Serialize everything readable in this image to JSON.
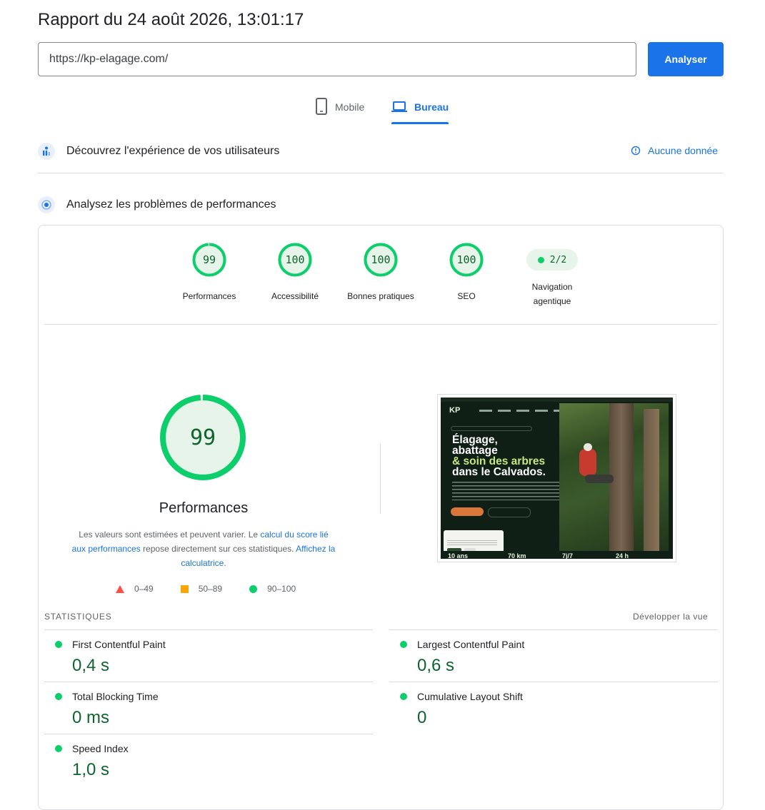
{
  "header": {
    "report_title": "Rapport du 24 août 2026, 13:01:17",
    "url_value": "https://kp-elagage.com/",
    "analyze_label": "Analyser"
  },
  "tabs": [
    {
      "label": "Mobile",
      "icon": "smartphone-icon",
      "selected": false
    },
    {
      "label": "Bureau",
      "icon": "laptop-icon",
      "selected": true
    }
  ],
  "field_data": {
    "title": "Découvrez l'expérience de vos utilisateurs",
    "status": "Aucune donnée"
  },
  "lab_data": {
    "title": "Analysez les problèmes de performances"
  },
  "scores": [
    {
      "score": 99,
      "label": "Performances"
    },
    {
      "score": 100,
      "label": "Accessibilité"
    },
    {
      "score": 100,
      "label": "Bonnes pratiques"
    },
    {
      "score": 100,
      "label": "SEO"
    }
  ],
  "agentic": {
    "value": "2/2",
    "label_line1": "Navigation",
    "label_line2": "agentique"
  },
  "performance": {
    "score": 99,
    "title": "Performances",
    "desc_1": "Les valeurs sont estimées et peuvent varier. Le ",
    "link_1": "calcul du score lié aux performances",
    "desc_2": " repose directement sur ces statistiques. ",
    "link_2": "Affichez la calculatrice",
    "desc_3": "."
  },
  "legend": [
    {
      "shape": "triangle",
      "range": "0–49",
      "color": "#ff4e42"
    },
    {
      "shape": "square",
      "range": "50–89",
      "color": "#ffa400"
    },
    {
      "shape": "circle",
      "range": "90–100",
      "color": "#0cce6b"
    }
  ],
  "screenshot": {
    "headline_1": "Élagage,",
    "headline_2": "abattage",
    "headline_3": "& soin des arbres",
    "headline_4": "dans le Calvados.",
    "stat_1": "10 ans",
    "stat_2": "70 km",
    "stat_3": "7j/7",
    "stat_4": "24 h"
  },
  "stats": {
    "header": "Statistiques",
    "expand": "Développer la vue",
    "metrics": [
      {
        "name": "First Contentful Paint",
        "value": "0,4 s"
      },
      {
        "name": "Largest Contentful Paint",
        "value": "0,6 s"
      },
      {
        "name": "Total Blocking Time",
        "value": "0 ms"
      },
      {
        "name": "Cumulative Layout Shift",
        "value": "0"
      },
      {
        "name": "Speed Index",
        "value": "1,0 s"
      }
    ]
  },
  "colors": {
    "accent": "#1a73e8",
    "pass": "#0cce6b",
    "pass_text": "#0d652d",
    "average": "#ffa400",
    "fail": "#ff4e42"
  }
}
